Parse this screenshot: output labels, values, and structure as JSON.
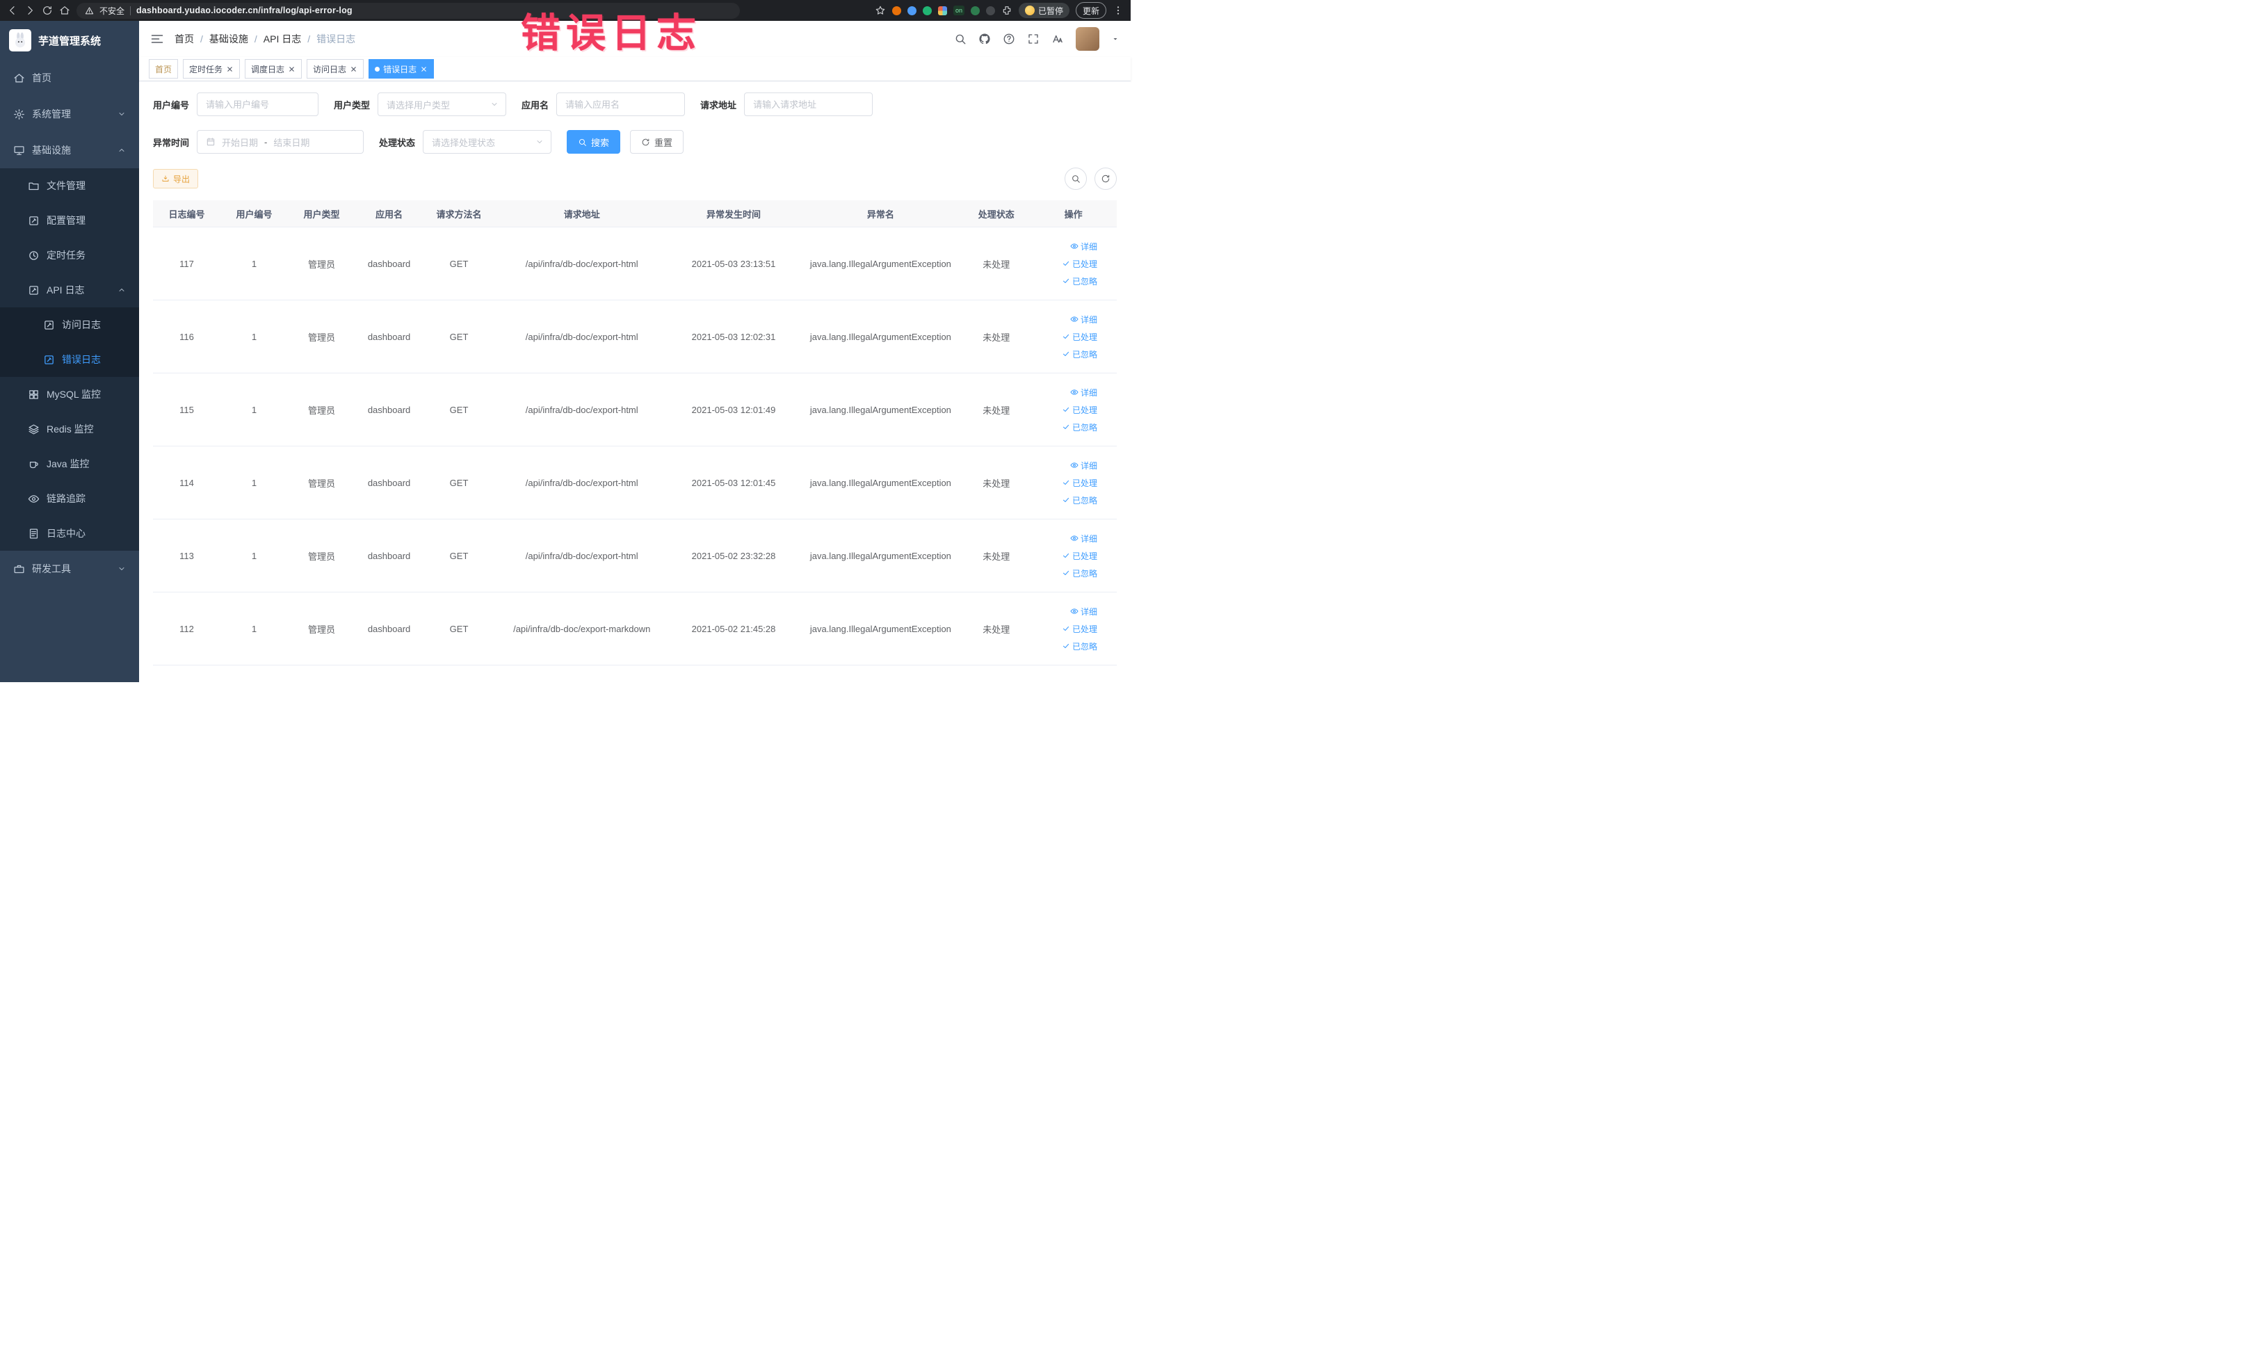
{
  "annotation": {
    "text": "错误日志"
  },
  "browser": {
    "security_label": "不安全",
    "url": "dashboard.yudao.iocoder.cn/infra/log/api-error-log",
    "on_badge": "on",
    "paused_label": "已暂停",
    "update_label": "更新"
  },
  "sidebar": {
    "app_title": "芋道管理系统",
    "items": [
      {
        "key": "home",
        "label": "首页",
        "icon": "home"
      },
      {
        "key": "system",
        "label": "系统管理",
        "icon": "gear",
        "collapsed": true
      },
      {
        "key": "infra",
        "label": "基础设施",
        "icon": "screen",
        "expanded": true,
        "children": [
          {
            "key": "file",
            "label": "文件管理",
            "icon": "folder"
          },
          {
            "key": "config",
            "label": "配置管理",
            "icon": "edit"
          },
          {
            "key": "job",
            "label": "定时任务",
            "icon": "clock"
          },
          {
            "key": "api-log",
            "label": "API 日志",
            "icon": "edit",
            "expanded": true,
            "children": [
              {
                "key": "access-log",
                "label": "访问日志",
                "icon": "edit"
              },
              {
                "key": "error-log",
                "label": "错误日志",
                "icon": "edit",
                "active": true
              }
            ]
          },
          {
            "key": "mysql",
            "label": "MySQL 监控",
            "icon": "grid"
          },
          {
            "key": "redis",
            "label": "Redis 监控",
            "icon": "layers"
          },
          {
            "key": "java",
            "label": "Java 监控",
            "icon": "coffee"
          },
          {
            "key": "trace",
            "label": "链路追踪",
            "icon": "eye"
          },
          {
            "key": "log-center",
            "label": "日志中心",
            "icon": "doc"
          }
        ]
      },
      {
        "key": "dev-tools",
        "label": "研发工具",
        "icon": "tool",
        "collapsed": true
      }
    ]
  },
  "header": {
    "breadcrumb": [
      "首页",
      "基础设施",
      "API 日志",
      "错误日志"
    ],
    "separator": "/"
  },
  "tabs": [
    {
      "label": "首页",
      "affix": true
    },
    {
      "label": "定时任务",
      "closable": true
    },
    {
      "label": "调度日志",
      "closable": true
    },
    {
      "label": "访问日志",
      "closable": true
    },
    {
      "label": "错误日志",
      "closable": true,
      "active": true
    }
  ],
  "filters": {
    "fields": [
      {
        "label": "用户编号",
        "placeholder": "请输入用户编号"
      },
      {
        "label": "用户类型",
        "placeholder": "请选择用户类型"
      },
      {
        "label": "应用名",
        "placeholder": "请输入应用名"
      },
      {
        "label": "请求地址",
        "placeholder": "请输入请求地址"
      },
      {
        "label": "异常时间",
        "start_placeholder": "开始日期",
        "end_placeholder": "结束日期",
        "separator": "-"
      },
      {
        "label": "处理状态",
        "placeholder": "请选择处理状态"
      }
    ],
    "search_label": "搜索",
    "reset_label": "重置"
  },
  "toolbar": {
    "export_label": "导出"
  },
  "table": {
    "columns": [
      "日志编号",
      "用户编号",
      "用户类型",
      "应用名",
      "请求方法名",
      "请求地址",
      "异常发生时间",
      "异常名",
      "处理状态",
      "操作"
    ],
    "rows": [
      {
        "id": "117",
        "user_id": "1",
        "user_type": "管理员",
        "app": "dashboard",
        "method": "GET",
        "url": "/api/infra/db-doc/export-html",
        "time": "2021-05-03 23:13:51",
        "exception": "java.lang.IllegalArgumentException",
        "status": "未处理"
      },
      {
        "id": "116",
        "user_id": "1",
        "user_type": "管理员",
        "app": "dashboard",
        "method": "GET",
        "url": "/api/infra/db-doc/export-html",
        "time": "2021-05-03 12:02:31",
        "exception": "java.lang.IllegalArgumentException",
        "status": "未处理"
      },
      {
        "id": "115",
        "user_id": "1",
        "user_type": "管理员",
        "app": "dashboard",
        "method": "GET",
        "url": "/api/infra/db-doc/export-html",
        "time": "2021-05-03 12:01:49",
        "exception": "java.lang.IllegalArgumentException",
        "status": "未处理"
      },
      {
        "id": "114",
        "user_id": "1",
        "user_type": "管理员",
        "app": "dashboard",
        "method": "GET",
        "url": "/api/infra/db-doc/export-html",
        "time": "2021-05-03 12:01:45",
        "exception": "java.lang.IllegalArgumentException",
        "status": "未处理"
      },
      {
        "id": "113",
        "user_id": "1",
        "user_type": "管理员",
        "app": "dashboard",
        "method": "GET",
        "url": "/api/infra/db-doc/export-html",
        "time": "2021-05-02 23:32:28",
        "exception": "java.lang.IllegalArgumentException",
        "status": "未处理"
      },
      {
        "id": "112",
        "user_id": "1",
        "user_type": "管理员",
        "app": "dashboard",
        "method": "GET",
        "url": "/api/infra/db-doc/export-markdown",
        "time": "2021-05-02 21:45:28",
        "exception": "java.lang.IllegalArgumentException",
        "status": "未处理"
      }
    ],
    "row_actions": [
      {
        "name": "detail",
        "label": "详细",
        "icon": "eye"
      },
      {
        "name": "processed",
        "label": "已处理",
        "icon": "check"
      },
      {
        "name": "ignored",
        "label": "已忽略",
        "icon": "check"
      }
    ]
  }
}
